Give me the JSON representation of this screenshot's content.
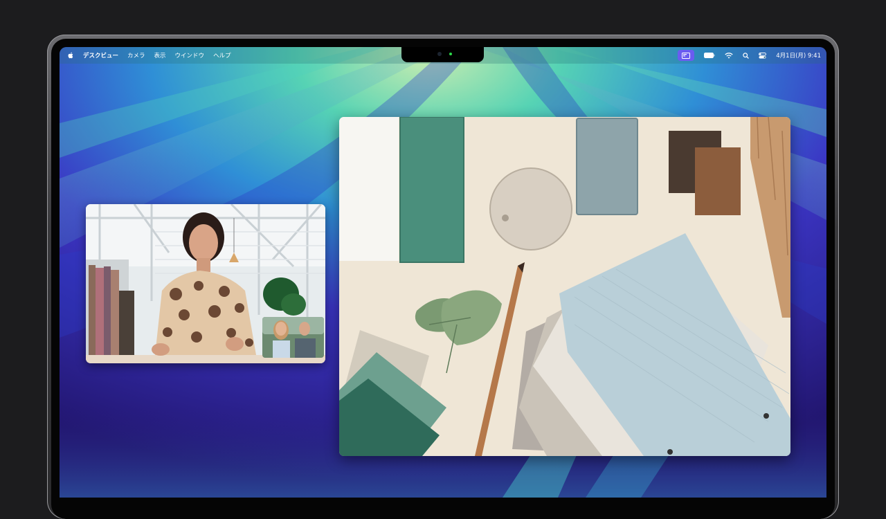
{
  "menubar": {
    "apple_icon": "apple-icon",
    "app_name": "デスクビュー",
    "menus": [
      "カメラ",
      "表示",
      "ウインドウ",
      "ヘルプ"
    ],
    "status_icons": [
      "desk-view-icon",
      "battery-icon",
      "wifi-icon",
      "search-icon",
      "control-center-icon"
    ],
    "datetime": "4月1日(月) 9:41"
  },
  "colors": {
    "wallpaper_purple": "#2a1e86",
    "wallpaper_teal": "#3fc7b8",
    "desk_view_accent": "#6a5cf0",
    "camera_led": "#2bd84a"
  },
  "windows": {
    "facetime_call": "facetime-video-window",
    "desk_view": "desk-view-window"
  }
}
